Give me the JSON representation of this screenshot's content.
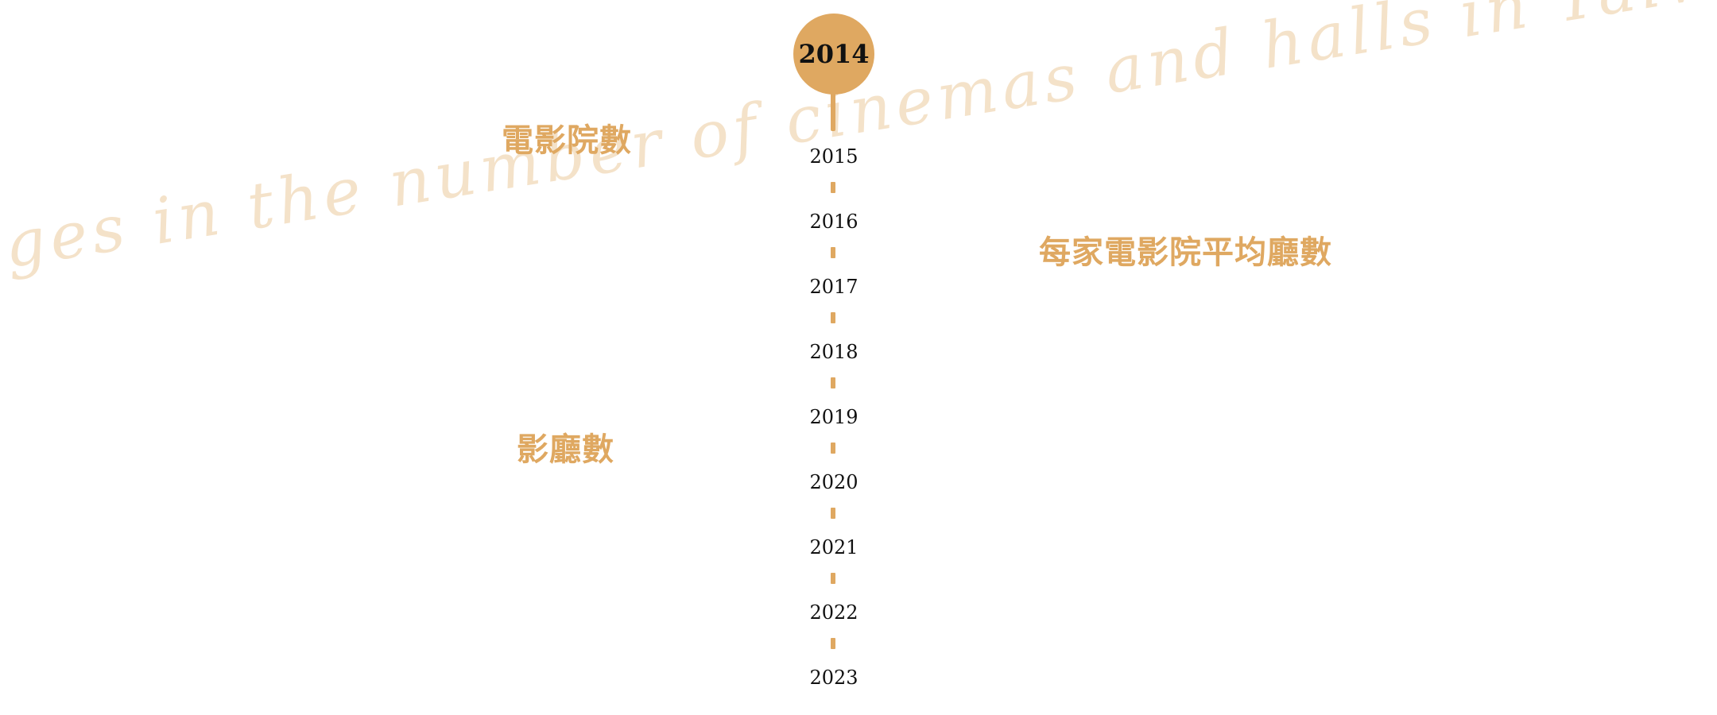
{
  "background_title": "Changes in the number of cinemas and halls in Taiwan",
  "labels": {
    "cinemas": "電影院數",
    "halls": "影廳數",
    "avg_halls": "每家電影院平均廳數"
  },
  "timeline": {
    "current_year": "2014",
    "years": [
      "2015",
      "2016",
      "2017",
      "2018",
      "2019",
      "2020",
      "2021",
      "2022",
      "2023"
    ]
  },
  "colors": {
    "accent": "#dfa861",
    "script_text": "#f3dfc4",
    "year_text": "#111111",
    "background": "#ffffff"
  }
}
